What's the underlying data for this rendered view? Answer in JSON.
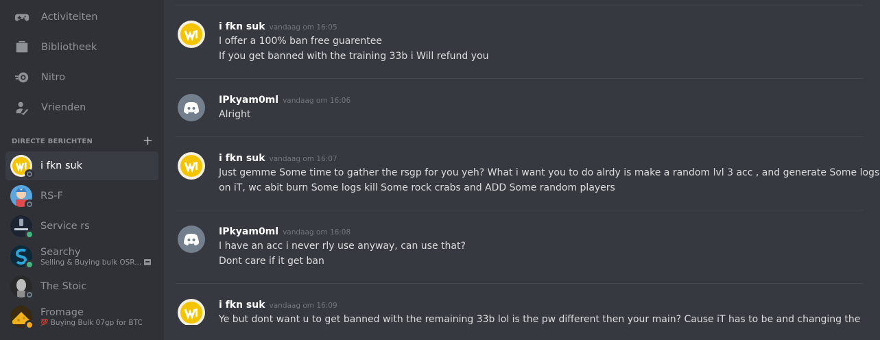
{
  "nav": {
    "items": [
      {
        "label": "Activiteiten",
        "icon": "gamepad-icon"
      },
      {
        "label": "Bibliotheek",
        "icon": "library-icon"
      },
      {
        "label": "Nitro",
        "icon": "nitro-icon"
      },
      {
        "label": "Vrienden",
        "icon": "friends-icon"
      }
    ]
  },
  "dm": {
    "header": "DIRECTE BERICHTEN",
    "add_symbol": "+",
    "items": [
      {
        "name": "i fkn suk",
        "status": "offline",
        "active": true
      },
      {
        "name": "RS-F",
        "status": "offline"
      },
      {
        "name": "Service rs",
        "status": "online"
      },
      {
        "name": "Searchy",
        "status": "online",
        "subtitle": "Selling & Buying bulk OSR..."
      },
      {
        "name": "The Stoic",
        "status": "offline"
      },
      {
        "name": "Fromage",
        "status": "idle",
        "subtitle": "Buying Bulk 07gp for BTC"
      }
    ]
  },
  "messages": [
    {
      "author": "i fkn suk",
      "time": "vandaag om 16:05",
      "lines": [
        "I offer a 100% ban free guarentee",
        "If you get banned with the training 33b i Will refund you"
      ]
    },
    {
      "author": "IPkyam0ml",
      "time": "vandaag om 16:06",
      "lines": [
        "Alright"
      ]
    },
    {
      "author": "i fkn suk",
      "time": "vandaag om 16:07",
      "lines": [
        "Just gemme Some time to gather the rsgp for you yeh? What i want you to do alrdy is make a random lvl 3 acc , and generate Some logs",
        "on iT, wc abit burn Some logs kill Some rock crabs and ADD Some random players"
      ]
    },
    {
      "author": "IPkyam0ml",
      "time": "vandaag om 16:08",
      "lines": [
        "I have an acc i never rly use anyway, can use that?",
        "Dont care if it get ban"
      ]
    },
    {
      "author": "i fkn suk",
      "time": "vandaag om 16:09",
      "lines": [
        "Ye but dont want u to get banned with the remaining 33b lol is the pw different then your main? Cause iT has to be and changing the"
      ]
    }
  ],
  "colors": {
    "sidebar_bg": "#2f3136",
    "chat_bg": "#36393f",
    "active_item": "#393c43",
    "online": "#43b581",
    "idle": "#faa61a",
    "offline": "#747f8d",
    "discord_blurple": "#7289da"
  }
}
